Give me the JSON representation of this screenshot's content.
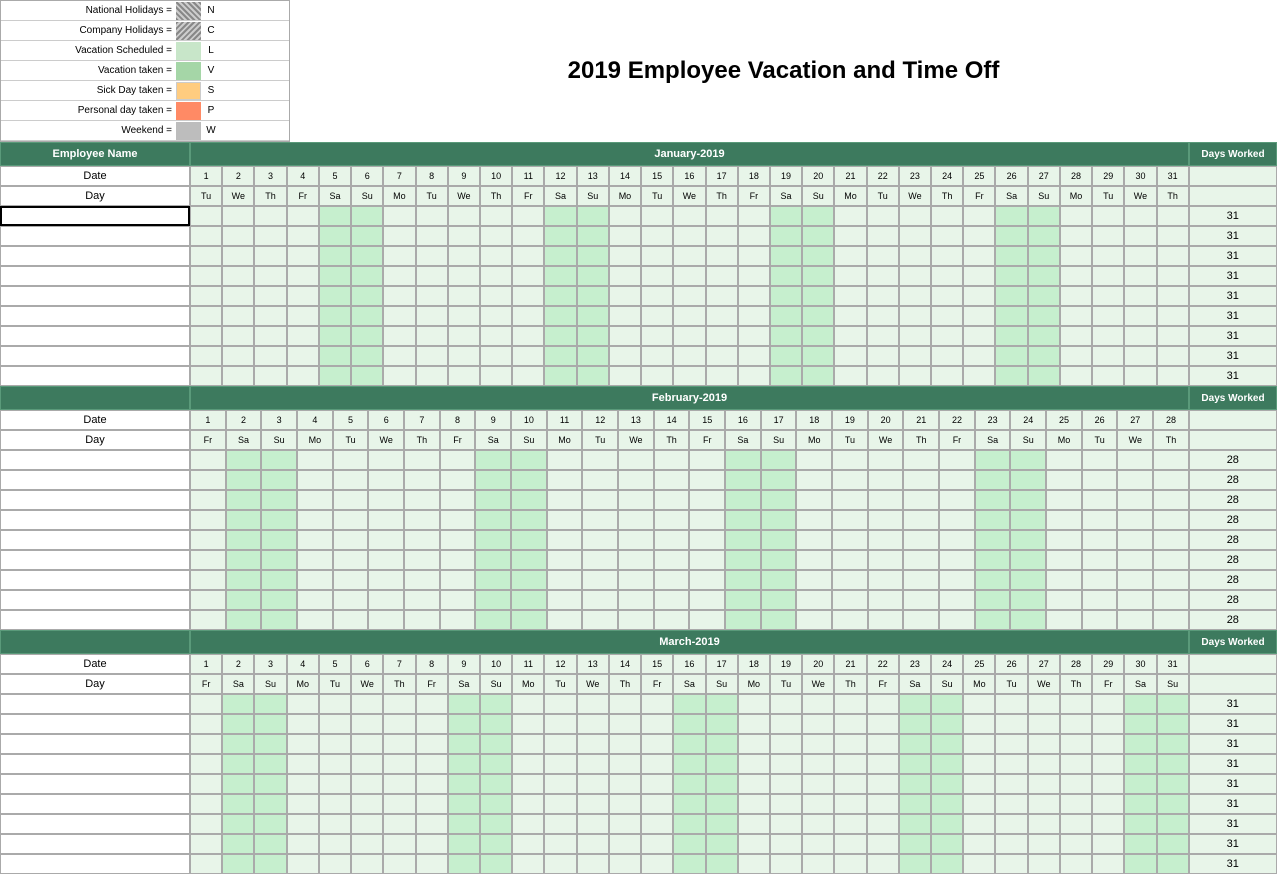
{
  "title": "2019 Employee Vacation and Time Off",
  "legend": {
    "items": [
      {
        "label": "National Holidays =",
        "code": "N",
        "swatch": "national"
      },
      {
        "label": "Company Holidays =",
        "code": "C",
        "swatch": "company"
      },
      {
        "label": "Vacation Scheduled =",
        "code": "L",
        "swatch": "vacation-sched"
      },
      {
        "label": "Vacation taken =",
        "code": "V",
        "swatch": "vacation-taken"
      },
      {
        "label": "Sick Day taken =",
        "code": "S",
        "swatch": "sick"
      },
      {
        "label": "Personal day taken =",
        "code": "P",
        "swatch": "personal"
      },
      {
        "label": "Weekend =",
        "code": "W",
        "swatch": "weekend"
      }
    ]
  },
  "months": [
    {
      "name": "January-2019",
      "days": 31,
      "day_names": [
        "Tu",
        "We",
        "Th",
        "Fr",
        "Sa",
        "Su",
        "Mo",
        "Tu",
        "We",
        "Th",
        "Fr",
        "Sa",
        "Su",
        "Mo",
        "Tu",
        "We",
        "Th",
        "Fr",
        "Sa",
        "Su",
        "Mo",
        "Tu",
        "We",
        "Th",
        "Fr",
        "Sa",
        "Su",
        "Mo",
        "Tu",
        "We",
        "Th"
      ],
      "weekend_cols": [
        5,
        6,
        12,
        13,
        19,
        20,
        26,
        27
      ],
      "days_worked": 31
    },
    {
      "name": "February-2019",
      "days": 28,
      "day_names": [
        "Fr",
        "Sa",
        "Su",
        "Mo",
        "Tu",
        "We",
        "Th",
        "Fr",
        "Sa",
        "Su",
        "Mo",
        "Tu",
        "We",
        "Th",
        "Fr",
        "Sa",
        "Su",
        "Mo",
        "Tu",
        "We",
        "Th",
        "Fr",
        "Sa",
        "Su",
        "Mo",
        "Tu",
        "We",
        "Th"
      ],
      "weekend_cols": [
        2,
        3,
        9,
        10,
        16,
        17,
        23,
        24
      ],
      "days_worked": 28
    },
    {
      "name": "March-2019",
      "days": 31,
      "day_names": [
        "Fr",
        "Sa",
        "Su",
        "Mo",
        "Tu",
        "We",
        "Th",
        "Fr",
        "Sa",
        "Su",
        "Mo",
        "Tu",
        "We",
        "Th",
        "Fr",
        "Sa",
        "Su",
        "Mo",
        "Tu",
        "We",
        "Th",
        "Fr",
        "Sa",
        "Su",
        "Mo",
        "Tu",
        "We",
        "Th",
        "Fr",
        "Sa",
        "Su"
      ],
      "weekend_cols": [
        2,
        3,
        9,
        10,
        16,
        17,
        23,
        24,
        30,
        31
      ],
      "days_worked": 31
    }
  ],
  "employees": [
    "",
    "",
    "",
    "",
    "",
    "",
    "",
    "",
    ""
  ],
  "days_worked_label": "Days Worked"
}
